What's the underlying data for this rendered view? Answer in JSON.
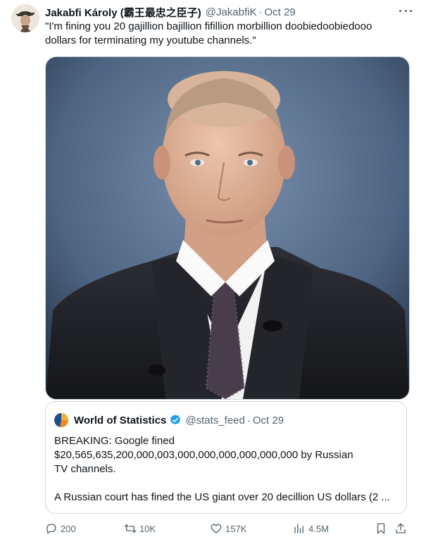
{
  "tweet": {
    "author_name": "Jakabfi Károly (霸王最忠之臣子)",
    "handle": "@JakabfiK",
    "separator": "·",
    "date": "Oct 29",
    "text": "\"I'm fining you 20 gajillion bajillion fifillion morbillion doobiedoobiedooo dollars for terminating my youtube channels.\""
  },
  "quote": {
    "author_name": "World of Statistics",
    "handle": "@stats_feed",
    "separator": "·",
    "date": "Oct 29",
    "line1": "BREAKING: Google fined",
    "line2": "$20,565,635,200,000,003,000,000,000,000,000,000 by Russian",
    "line3": "TV channels.",
    "line4": "A Russian court has fined the US giant over 20 decillion US dollars (2 ..."
  },
  "actions": {
    "replies": "200",
    "reposts": "10K",
    "likes": "157K",
    "views": "4.5M"
  },
  "icons": {
    "more": "more-icon",
    "verified": "verified-badge-icon",
    "reply": "reply-icon",
    "repost": "repost-icon",
    "like": "like-icon",
    "views": "views-icon",
    "bookmark": "bookmark-icon",
    "share": "share-icon"
  },
  "colors": {
    "text": "#0f1419",
    "secondary": "#536471",
    "border": "#cfd9de",
    "verified": "#1d9bf0"
  }
}
